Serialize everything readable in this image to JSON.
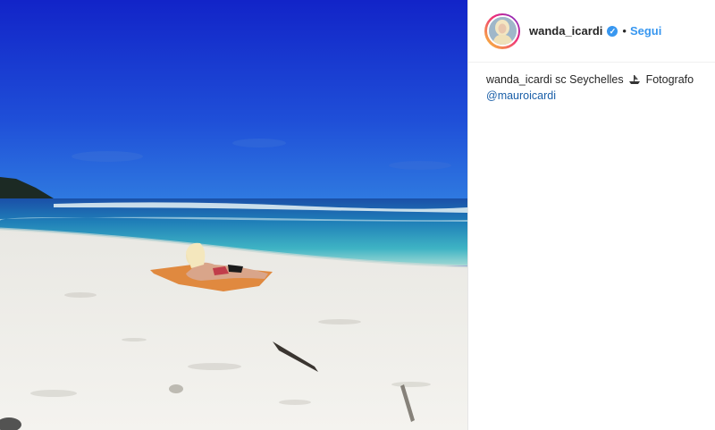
{
  "post": {
    "username": "wanda_icardi",
    "verified_icon": "verified-badge-icon",
    "separator": "•",
    "follow_label": "Segui",
    "caption": {
      "username": "wanda_icardi",
      "text_before": "sc Seychelles",
      "emoji": "boat-icon",
      "text_after": "Fotografo",
      "mention": "@mauroicardi"
    }
  },
  "colors": {
    "link_blue": "#3897f0",
    "sky": "#1a2fd0",
    "sand": "#f0efec"
  }
}
